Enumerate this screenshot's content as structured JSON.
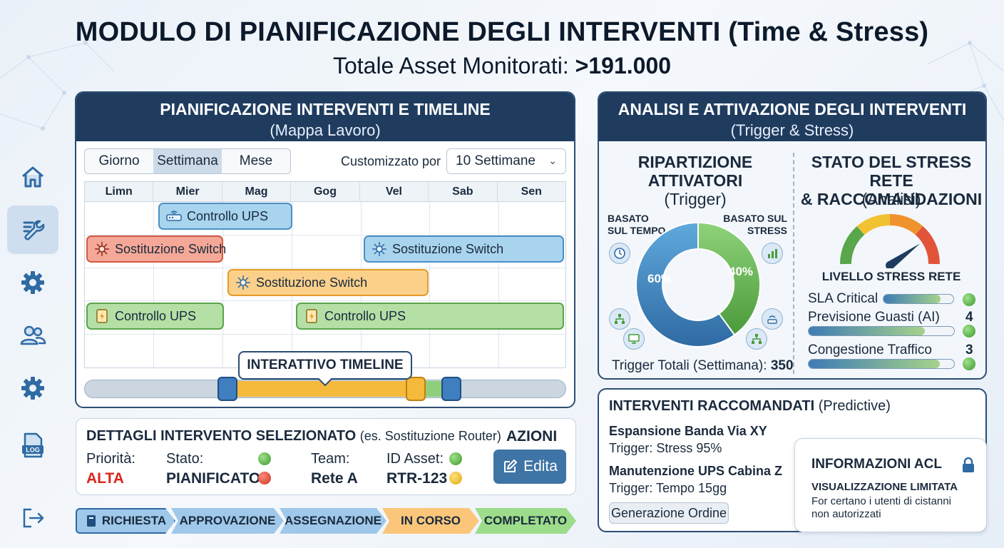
{
  "header": {
    "title": "MODULO DI PIANIFICAZIONE DEGLI INTERVENTI (Time & Stress)",
    "subtitle_label": "Totale Asset Monitorati:",
    "subtitle_value": ">191.000"
  },
  "sidebar": {
    "items": [
      {
        "icon": "home-icon"
      },
      {
        "icon": "wrench-icon",
        "active": true
      },
      {
        "icon": "gear-icon"
      },
      {
        "icon": "users-icon"
      },
      {
        "icon": "gear-icon"
      },
      {
        "icon": "log-file-icon",
        "label": "LOG"
      },
      {
        "icon": "logout-icon"
      }
    ]
  },
  "planning": {
    "title": "PIANIFICAZIONE INTERVENTI E TIMELINE",
    "subtitle": "(Mappa Lavoro)",
    "views": [
      "Giorno",
      "Settimana",
      "Mese"
    ],
    "selected_view": "Settimana",
    "custom_label": "Customizzato por",
    "custom_value": "10 Settimane",
    "days": [
      "Limn",
      "Mier",
      "Mag",
      "Gog",
      "Vel",
      "Sab",
      "Sen"
    ],
    "tasks": [
      {
        "label": "Controllo UPS",
        "color": "blue",
        "icon": "router-icon"
      },
      {
        "label": "Sostituzione Switch",
        "color": "red",
        "icon": "network-switch-icon"
      },
      {
        "label": "Sostituzione Switch",
        "color": "blue",
        "icon": "network-switch-icon"
      },
      {
        "label": "Sostituzione Switch",
        "color": "orange",
        "icon": "network-switch-icon"
      },
      {
        "label": "Controllo UPS",
        "color": "green",
        "icon": "battery-ups-icon"
      },
      {
        "label": "Controllo UPS",
        "color": "green",
        "icon": "battery-ups-icon"
      }
    ],
    "timeline_label": "INTERATTIVO TIMELINE"
  },
  "details": {
    "title": "DETTAGLI INTERVENTO SELEZIONATO",
    "title_example": "(es. Sostituzione Router)",
    "priority_label": "Priorità:",
    "priority_value": "ALTA",
    "status_label": "Stato:",
    "status_value": "PIANIFICATO",
    "team_label": "Team:",
    "team_value": "Rete A",
    "asset_label": "ID Asset:",
    "asset_value": "RTR-123",
    "actions_label": "AZIONI",
    "edit_label": "Edita"
  },
  "workflow": {
    "steps": [
      "RICHIESTA",
      "APPROVAZIONE",
      "ASSEGNAZIONE",
      "IN CORSO",
      "COMPLETATO"
    ]
  },
  "analysis": {
    "title": "ANALISI E ATTIVAZIONE DEGLI INTERVENTI",
    "subtitle": "(Trigger & Stress)",
    "left_title_1": "RIPARTIZIONE",
    "left_title_2": "ATTIVATORI",
    "left_subtitle": "(Trigger)",
    "time_label_1": "BASATO",
    "time_label_2": "SUL TEMPO",
    "stress_label_1": "BASATO SUL",
    "stress_label_2": "STRESS",
    "time_pct": "60%",
    "stress_pct": "40%",
    "total_label": "Trigger Totali (Settimana):",
    "total_value": "350",
    "right_title_1": "STATO DEL STRESS RETE",
    "right_title_2": "& RACCOMANDAZIONI",
    "right_subtitle": "(Analisi)",
    "gauge_label": "LIVELLO STRESS RETE",
    "gauge_level": 0.8,
    "metrics": [
      {
        "label": "SLA Critical",
        "value": "",
        "fill": 0.82
      },
      {
        "label": "Previsione Guasti (AI)",
        "value": "4",
        "fill": 0.8
      },
      {
        "label": "Congestione Traffico",
        "value": "3",
        "fill": 0.9
      }
    ]
  },
  "recommended": {
    "title": "INTERVENTI RACCOMANDATI",
    "title_suffix": "(Predictive)",
    "items": [
      {
        "name": "Espansione Banda Via XY",
        "trigger": "Trigger: Stress 95%"
      },
      {
        "name": "Manutenzione UPS Cabina Z",
        "trigger": "Trigger: Tempo 15gg"
      }
    ],
    "button_label": "Generazione Ordine"
  },
  "acl": {
    "title": "INFORMAZIONI ACL",
    "subtitle": "VISUALIZZAZIONE LIMITATA",
    "text_1": "For certano i utenti di cistanni",
    "text_2": "non autorizzati"
  }
}
